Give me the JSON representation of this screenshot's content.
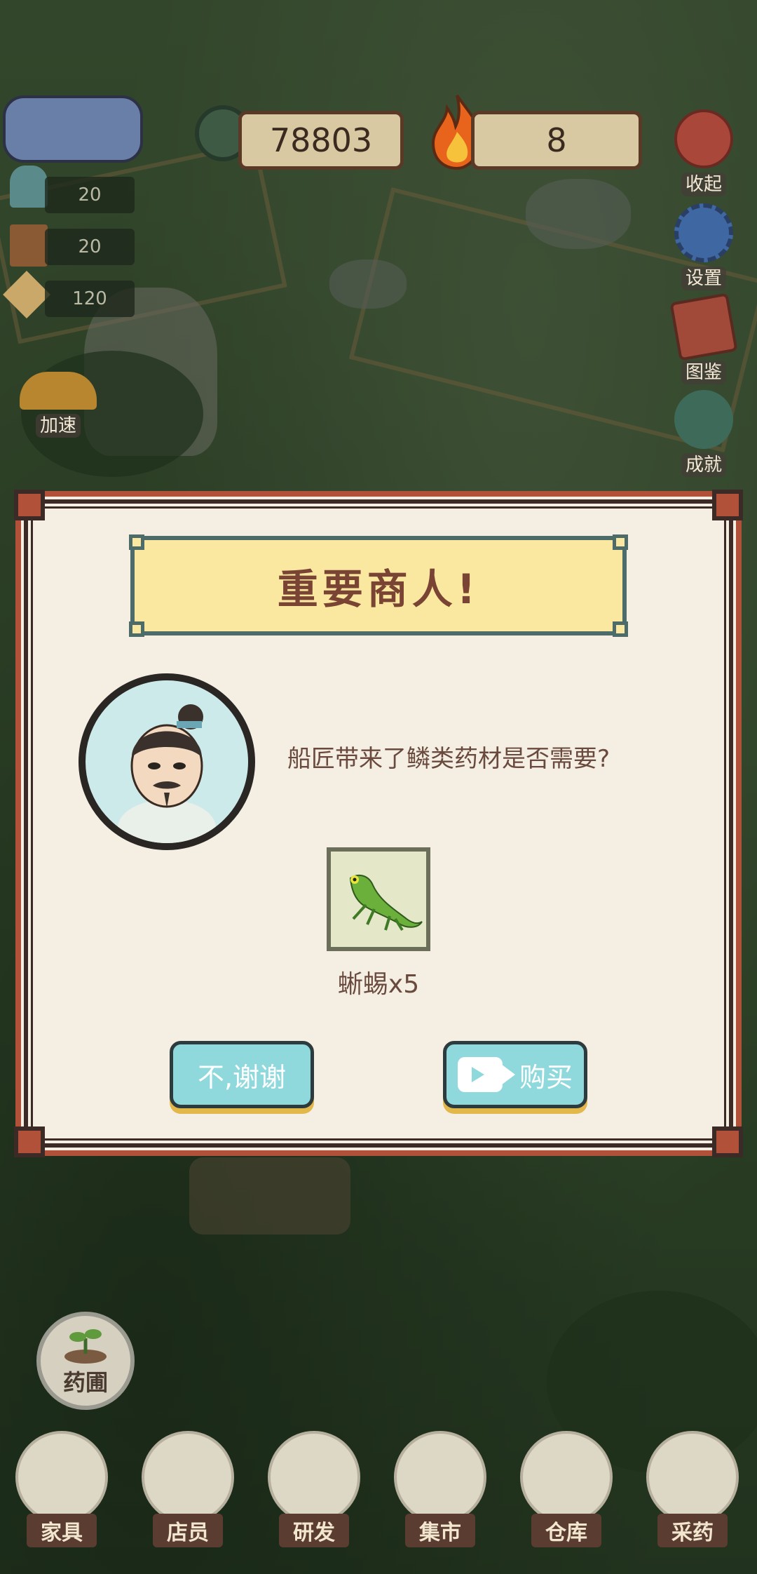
{
  "hud": {
    "coins": "78803",
    "flames": "8"
  },
  "side_buttons": [
    {
      "name": "collapse",
      "label": "收起",
      "icon": "yin-yang-icon"
    },
    {
      "name": "settings",
      "label": "设置",
      "icon": "gear-icon"
    },
    {
      "name": "codex",
      "label": "图鉴",
      "icon": "book-icon"
    },
    {
      "name": "achievements",
      "label": "成就",
      "icon": "dragon-icon"
    }
  ],
  "left_panel": {
    "stats": [
      {
        "icon": "staff-girl-icon",
        "value": "20"
      },
      {
        "icon": "chair-icon",
        "value": "20"
      },
      {
        "icon": "parcel-icon",
        "value": "120"
      }
    ],
    "speedup_label": "加速"
  },
  "dialog": {
    "title": "重要商人!",
    "message": "船匠带来了鳞类药材是否需要?",
    "item": {
      "name": "lizard-icon",
      "label": "蜥蜴x5"
    },
    "decline_label": "不,谢谢",
    "buy_label": "购买"
  },
  "herb_garden": {
    "label": "药圃"
  },
  "bottom_nav": [
    {
      "label": "家具",
      "icon": "chair-icon"
    },
    {
      "label": "店员",
      "icon": "staff-girl-icon"
    },
    {
      "label": "研发",
      "icon": "parcel-icon"
    },
    {
      "label": "集市",
      "icon": "market-banner-icon"
    },
    {
      "label": "仓库",
      "icon": "bundle-icon"
    },
    {
      "label": "采药",
      "icon": "mountain-icon"
    }
  ],
  "colors": {
    "dialog_border": "#b2513a",
    "banner_fill": "#fbe8a0",
    "button_fill": "#8fd9dd",
    "text_brown": "#6a4a3e"
  }
}
